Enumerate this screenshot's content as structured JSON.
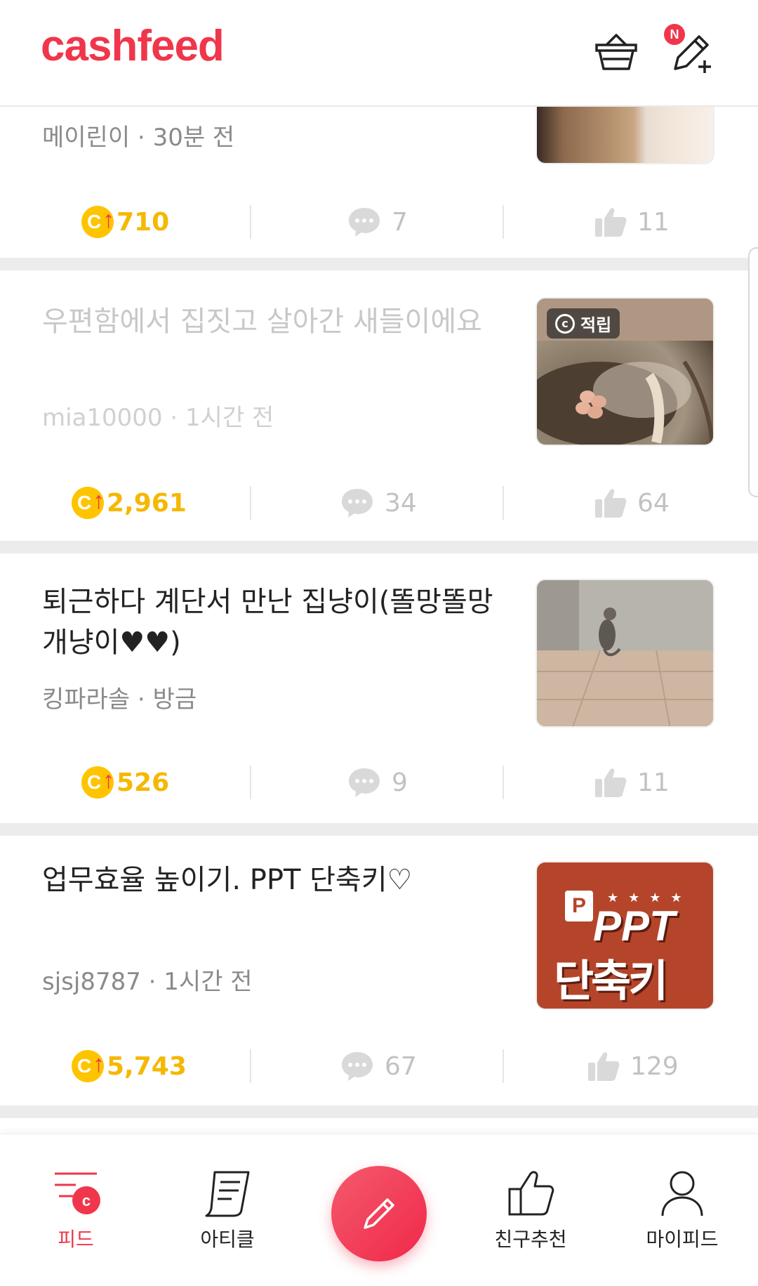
{
  "header": {
    "logo": "cashfeed",
    "new_badge": "N"
  },
  "posts": [
    {
      "title": "",
      "author": "메이린이",
      "time": "30분 전",
      "coins": "710",
      "comments": "7",
      "likes": "11"
    },
    {
      "title": "우편함에서 집짓고 살아간 새들이에요",
      "author": "mia10000",
      "time": "1시간 전",
      "coins": "2,961",
      "comments": "34",
      "likes": "64",
      "thumb_badge": "적립"
    },
    {
      "title": "퇴근하다 계단서  만난 집냥이(똘망똘망 개냥이♥♥)",
      "author": "킹파라솔",
      "time": "방금",
      "coins": "526",
      "comments": "9",
      "likes": "11"
    },
    {
      "title": "업무효율 높이기. PPT 단축키♡",
      "author": "sjsj8787",
      "time": "1시간 전",
      "coins": "5,743",
      "comments": "67",
      "likes": "129",
      "thumb_text_1": "PPT",
      "thumb_text_2": "단축키"
    }
  ],
  "meta_separator": " · ",
  "coin_letter": "C",
  "nav": {
    "feed": "피드",
    "article": "아티클",
    "friend_recommend": "친구추천",
    "my_feed": "마이피드",
    "feed_badge": "c"
  },
  "colors": {
    "brand": "#f0364b",
    "coin": "#ffc400",
    "coin_text": "#f5b800"
  }
}
